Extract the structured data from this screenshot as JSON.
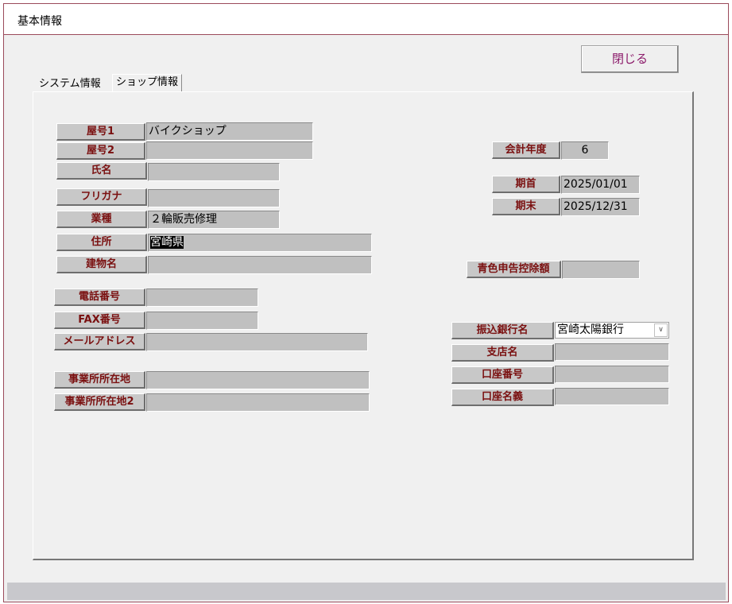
{
  "window": {
    "title": "基本情報"
  },
  "close_button": {
    "label": "閉じる"
  },
  "tabs": [
    {
      "label": "システム情報",
      "active": false
    },
    {
      "label": "ショップ情報",
      "active": true
    }
  ],
  "shop": {
    "yago1": {
      "label": "屋号1",
      "value": "バイクショップ"
    },
    "yago2": {
      "label": "屋号2",
      "value": ""
    },
    "shimei": {
      "label": "氏名",
      "value": ""
    },
    "furigana": {
      "label": "フリガナ",
      "value": ""
    },
    "gyoshu": {
      "label": "業種",
      "value": "２輪販売修理"
    },
    "jusho": {
      "label": "住所",
      "value": "宮崎県"
    },
    "tatemono": {
      "label": "建物名",
      "value": ""
    },
    "tel": {
      "label": "電話番号",
      "value": ""
    },
    "fax": {
      "label": "FAX番号",
      "value": ""
    },
    "email": {
      "label": "メールアドレス",
      "value": ""
    },
    "jigyosho1": {
      "label": "事業所所在地",
      "value": ""
    },
    "jigyosho2": {
      "label": "事業所所在地2",
      "value": ""
    }
  },
  "accounting": {
    "fiscal_year": {
      "label": "会計年度",
      "value": "6"
    },
    "period_start": {
      "label": "期首",
      "value": "2025/01/01"
    },
    "period_end": {
      "label": "期末",
      "value": "2025/12/31"
    },
    "blue_deduction": {
      "label": "青色申告控除額",
      "value": ""
    }
  },
  "bank": {
    "bank_name": {
      "label": "振込銀行名",
      "value": "宮崎太陽銀行"
    },
    "branch": {
      "label": "支店名",
      "value": ""
    },
    "account_number": {
      "label": "口座番号",
      "value": ""
    },
    "account_name": {
      "label": "口座名義",
      "value": ""
    }
  },
  "colors": {
    "border_accent": "#9b4a5a",
    "label_text": "#7a1010",
    "button_text": "#8b1a6a"
  }
}
